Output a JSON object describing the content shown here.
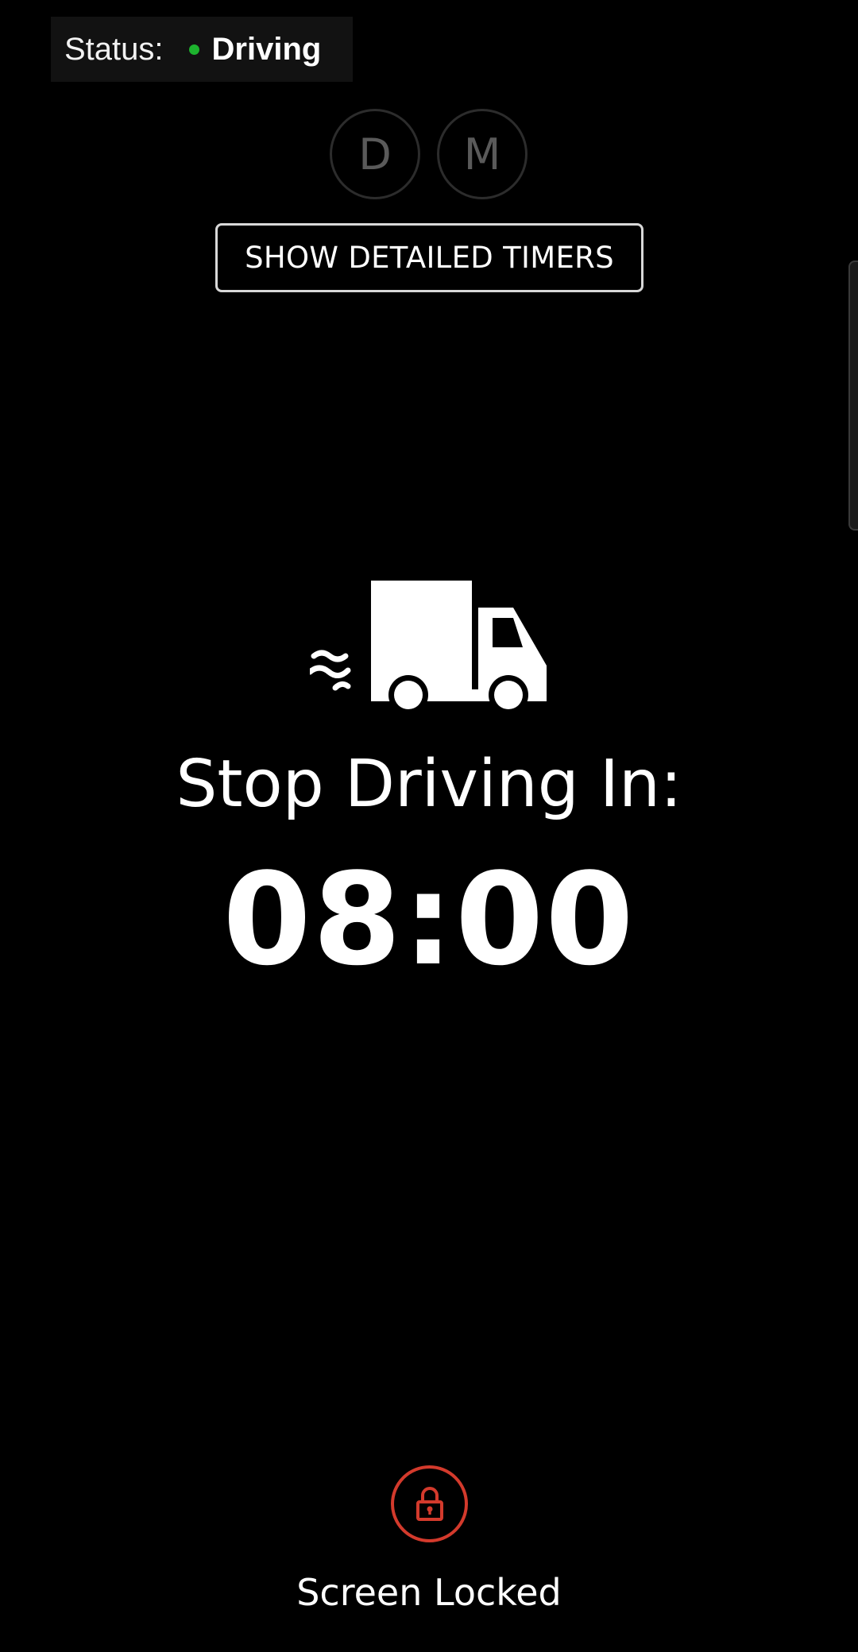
{
  "status": {
    "label": "Status:",
    "value": "Driving",
    "dot_color": "#1db32e"
  },
  "mode_buttons": [
    {
      "label": "D"
    },
    {
      "label": "M"
    }
  ],
  "timers_button": {
    "label": "SHOW DETAILED TIMERS"
  },
  "main": {
    "icon": "moving-truck-icon",
    "heading": "Stop Driving In:",
    "countdown": "08:00"
  },
  "lock": {
    "icon": "padlock-icon",
    "label": "Screen Locked",
    "color": "#d33a2c"
  }
}
